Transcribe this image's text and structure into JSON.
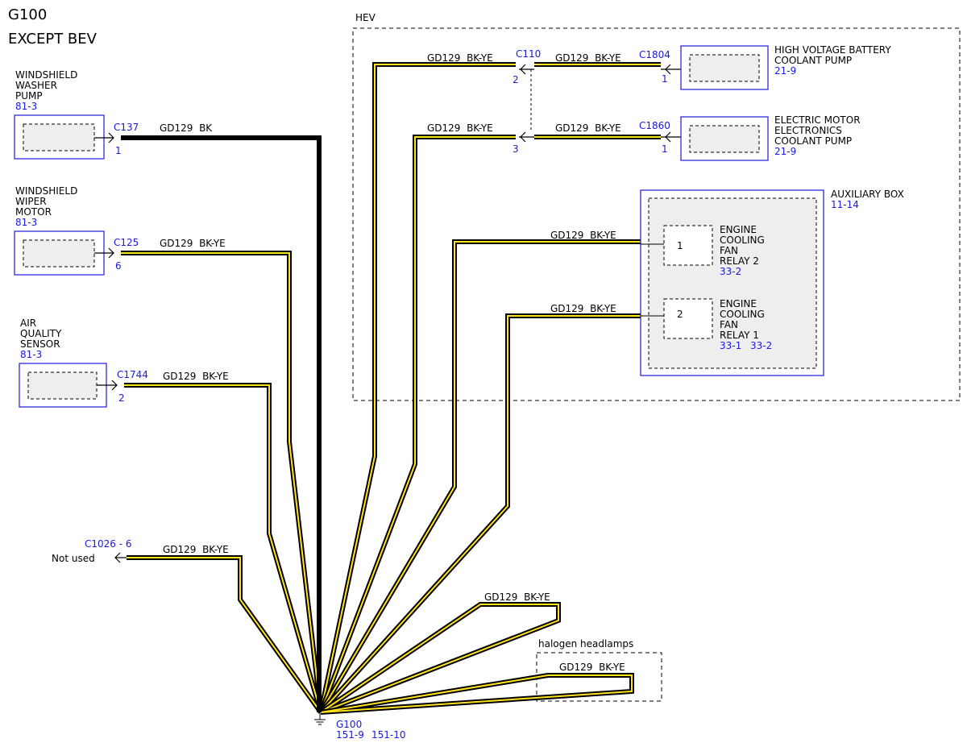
{
  "title": {
    "line1": "G100",
    "line2": "EXCEPT BEV"
  },
  "zones": {
    "hev": "HEV",
    "halogen": "halogen headlamps"
  },
  "components": {
    "washer": {
      "l1": "WINDSHIELD",
      "l2": "WASHER",
      "l3": "PUMP",
      "ref": "81-3"
    },
    "wiper": {
      "l1": "WINDSHIELD",
      "l2": "WIPER",
      "l3": "MOTOR",
      "ref": "81-3"
    },
    "aqs": {
      "l1": "AIR",
      "l2": "QUALITY",
      "l3": "SENSOR",
      "ref": "81-3"
    },
    "hvb": {
      "l1": "HIGH VOLTAGE BATTERY",
      "l2": "COOLANT PUMP",
      "ref": "21-9"
    },
    "emec": {
      "l1": "ELECTRIC MOTOR",
      "l2": "ELECTRONICS",
      "l3": "COOLANT PUMP",
      "ref": "21-9"
    },
    "aux": {
      "name": "AUXILIARY BOX",
      "ref": "11-14"
    },
    "relay2": {
      "pin": "1",
      "l1": "ENGINE",
      "l2": "COOLING",
      "l3": "FAN",
      "l4": "RELAY 2",
      "ref": "33-2"
    },
    "relay1": {
      "pin": "2",
      "l1": "ENGINE",
      "l2": "COOLING",
      "l3": "FAN",
      "l4": "RELAY 1",
      "ref1": "33-1",
      "ref2": "33-2"
    }
  },
  "connectors": {
    "c137": {
      "id": "C137",
      "pin": "1"
    },
    "c125": {
      "id": "C125",
      "pin": "6"
    },
    "c1744": {
      "id": "C1744",
      "pin": "2"
    },
    "c110": {
      "id": "C110",
      "pin_a": "2",
      "pin_b": "3"
    },
    "c1804": {
      "id": "C1804",
      "pin": "1"
    },
    "c1860": {
      "id": "C1860",
      "pin": "1"
    },
    "c1026": {
      "id": "C1026 - 6",
      "note": "Not used"
    }
  },
  "wires": {
    "washer": "GD129  BK",
    "wiper": "GD129  BK-YE",
    "aqs": "GD129  BK-YE",
    "c1026": "GD129  BK-YE",
    "c110_pin2": "GD129  BK-YE",
    "hvb": "GD129  BK-YE",
    "c110_pin3": "GD129  BK-YE",
    "emec": "GD129  BK-YE",
    "relay2": "GD129  BK-YE",
    "relay1": "GD129  BK-YE",
    "loop": "GD129  BK-YE",
    "halogen": "GD129  BK-YE"
  },
  "ground": {
    "id": "G100",
    "ref1": "151-9",
    "ref2": "151-10"
  },
  "colors": {
    "component_blue": "#1a1adc",
    "wire_black": "#000000",
    "wire_yellow": "#ffe21a"
  }
}
